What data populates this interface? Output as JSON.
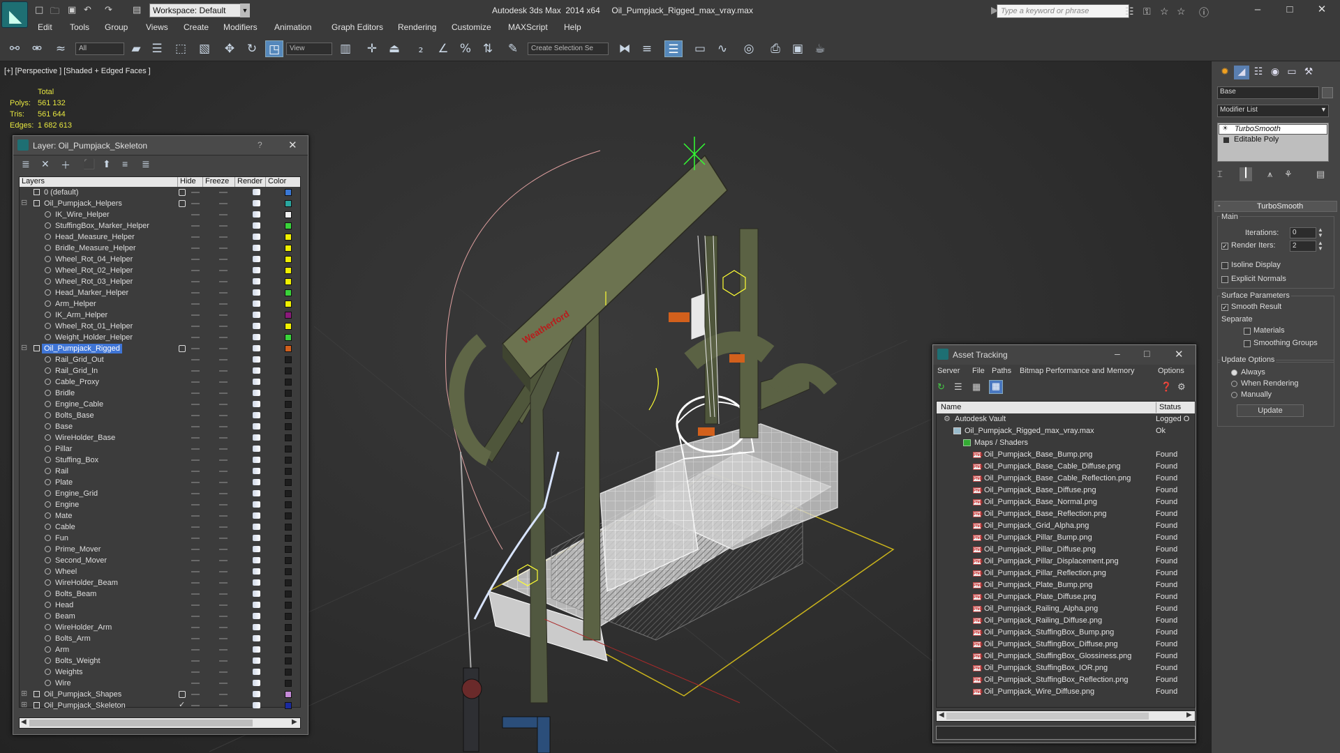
{
  "app": {
    "title": "Autodesk 3ds Max  2014 x64     Oil_Pumpjack_Rigged_max_vray.max",
    "workspace": "Workspace: Default",
    "search_placeholder": "Type a keyword or phrase"
  },
  "menu": [
    "Edit",
    "Tools",
    "Group",
    "Views",
    "Create",
    "Modifiers",
    "Animation",
    "Graph Editors",
    "Rendering",
    "Customize",
    "MAXScript",
    "Help"
  ],
  "toolbar": {
    "selection_filter": "All",
    "reference_coord": "View",
    "selection_set": "Create Selection Se"
  },
  "viewport": {
    "label": "[+] [Perspective ] [Shaded + Edged Faces ]",
    "stats_header": "Total",
    "stats": [
      {
        "k": "Polys:",
        "v": "561 132"
      },
      {
        "k": "Tris:",
        "v": "561 644"
      },
      {
        "k": "Edges:",
        "v": "1 682 613"
      }
    ],
    "decal_text": "Weatherford"
  },
  "layer_dialog": {
    "title": "Layer: Oil_Pumpjack_Skeleton",
    "help": "?",
    "columns": [
      "Layers",
      "Hide",
      "Freeze",
      "Render",
      "Color"
    ],
    "rows": [
      {
        "name": "0 (default)",
        "level": 0,
        "kind": "layer",
        "color": "#3a78d6",
        "cb": true
      },
      {
        "name": "Oil_Pumpjack_Helpers",
        "level": 0,
        "kind": "layer",
        "color": "#2aa7a0",
        "cb": true,
        "expand": "-"
      },
      {
        "name": "IK_Wire_Helper",
        "level": 1,
        "kind": "obj",
        "color": "#f2f2f2"
      },
      {
        "name": "StuffingBox_Marker_Helper",
        "level": 1,
        "kind": "obj",
        "color": "#3ad33a"
      },
      {
        "name": "Head_Measure_Helper",
        "level": 1,
        "kind": "obj",
        "color": "#f0f000"
      },
      {
        "name": "Bridle_Measure_Helper",
        "level": 1,
        "kind": "obj",
        "color": "#f0f000"
      },
      {
        "name": "Wheel_Rot_04_Helper",
        "level": 1,
        "kind": "obj",
        "color": "#f0f000"
      },
      {
        "name": "Wheel_Rot_02_Helper",
        "level": 1,
        "kind": "obj",
        "color": "#f0f000"
      },
      {
        "name": "Wheel_Rot_03_Helper",
        "level": 1,
        "kind": "obj",
        "color": "#f0f000"
      },
      {
        "name": "Head_Marker_Helper",
        "level": 1,
        "kind": "obj",
        "color": "#3ad33a"
      },
      {
        "name": "Arm_Helper",
        "level": 1,
        "kind": "obj",
        "color": "#f0f000"
      },
      {
        "name": "IK_Arm_Helper",
        "level": 1,
        "kind": "obj",
        "color": "#8a1a7a"
      },
      {
        "name": "Wheel_Rot_01_Helper",
        "level": 1,
        "kind": "obj",
        "color": "#f0f000"
      },
      {
        "name": "Weight_Holder_Helper",
        "level": 1,
        "kind": "obj",
        "color": "#3ad33a"
      },
      {
        "name": "Oil_Pumpjack_Rigged",
        "level": 0,
        "kind": "layer",
        "color": "#d2601c",
        "cb": true,
        "expand": "-",
        "selected": true
      },
      {
        "name": "Rail_Grid_Out",
        "level": 1,
        "kind": "obj",
        "color": "#1e1e1e"
      },
      {
        "name": "Rail_Grid_In",
        "level": 1,
        "kind": "obj",
        "color": "#1e1e1e"
      },
      {
        "name": "Cable_Proxy",
        "level": 1,
        "kind": "obj",
        "color": "#1e1e1e"
      },
      {
        "name": "Bridle",
        "level": 1,
        "kind": "obj",
        "color": "#1e1e1e"
      },
      {
        "name": "Engine_Cable",
        "level": 1,
        "kind": "obj",
        "color": "#1e1e1e"
      },
      {
        "name": "Bolts_Base",
        "level": 1,
        "kind": "obj",
        "color": "#1e1e1e"
      },
      {
        "name": "Base",
        "level": 1,
        "kind": "obj",
        "color": "#1e1e1e"
      },
      {
        "name": "WireHolder_Base",
        "level": 1,
        "kind": "obj",
        "color": "#1e1e1e"
      },
      {
        "name": "Pillar",
        "level": 1,
        "kind": "obj",
        "color": "#1e1e1e"
      },
      {
        "name": "Stuffing_Box",
        "level": 1,
        "kind": "obj",
        "color": "#1e1e1e"
      },
      {
        "name": "Rail",
        "level": 1,
        "kind": "obj",
        "color": "#1e1e1e"
      },
      {
        "name": "Plate",
        "level": 1,
        "kind": "obj",
        "color": "#1e1e1e"
      },
      {
        "name": "Engine_Grid",
        "level": 1,
        "kind": "obj",
        "color": "#1e1e1e"
      },
      {
        "name": "Engine",
        "level": 1,
        "kind": "obj",
        "color": "#1e1e1e"
      },
      {
        "name": "Mate",
        "level": 1,
        "kind": "obj",
        "color": "#1e1e1e"
      },
      {
        "name": "Cable",
        "level": 1,
        "kind": "obj",
        "color": "#1e1e1e"
      },
      {
        "name": "Fun",
        "level": 1,
        "kind": "obj",
        "color": "#1e1e1e"
      },
      {
        "name": "Prime_Mover",
        "level": 1,
        "kind": "obj",
        "color": "#1e1e1e"
      },
      {
        "name": "Second_Mover",
        "level": 1,
        "kind": "obj",
        "color": "#1e1e1e"
      },
      {
        "name": "Wheel",
        "level": 1,
        "kind": "obj",
        "color": "#1e1e1e"
      },
      {
        "name": "WireHolder_Beam",
        "level": 1,
        "kind": "obj",
        "color": "#1e1e1e"
      },
      {
        "name": "Bolts_Beam",
        "level": 1,
        "kind": "obj",
        "color": "#1e1e1e"
      },
      {
        "name": "Head",
        "level": 1,
        "kind": "obj",
        "color": "#1e1e1e"
      },
      {
        "name": "Beam",
        "level": 1,
        "kind": "obj",
        "color": "#1e1e1e"
      },
      {
        "name": "WireHolder_Arm",
        "level": 1,
        "kind": "obj",
        "color": "#1e1e1e"
      },
      {
        "name": "Bolts_Arm",
        "level": 1,
        "kind": "obj",
        "color": "#1e1e1e"
      },
      {
        "name": "Arm",
        "level": 1,
        "kind": "obj",
        "color": "#1e1e1e"
      },
      {
        "name": "Bolts_Weight",
        "level": 1,
        "kind": "obj",
        "color": "#1e1e1e"
      },
      {
        "name": "Weights",
        "level": 1,
        "kind": "obj",
        "color": "#1e1e1e"
      },
      {
        "name": "Wire",
        "level": 1,
        "kind": "obj",
        "color": "#1e1e1e"
      },
      {
        "name": "Oil_Pumpjack_Shapes",
        "level": 0,
        "kind": "layer",
        "color": "#c58ad8",
        "cb": true,
        "expand": "+"
      },
      {
        "name": "Oil_Pumpjack_Skeleton",
        "level": 0,
        "kind": "layer",
        "color": "#1a2aa0",
        "check": true,
        "expand": "+"
      }
    ]
  },
  "asset_dialog": {
    "title": "Asset Tracking",
    "menu": [
      "Server",
      "File",
      "Paths",
      "Bitmap Performance and Memory",
      "Options"
    ],
    "columns": [
      "Name",
      "Status"
    ],
    "rows": [
      {
        "name": "Autodesk Vault",
        "status": "Logged O",
        "indent": 0,
        "icon": "vault"
      },
      {
        "name": "Oil_Pumpjack_Rigged_max_vray.max",
        "status": "Ok",
        "indent": 1,
        "icon": "max"
      },
      {
        "name": "Maps / Shaders",
        "status": "",
        "indent": 2,
        "icon": "maps"
      },
      {
        "name": "Oil_Pumpjack_Base_Bump.png",
        "status": "Found",
        "indent": 3,
        "icon": "png"
      },
      {
        "name": "Oil_Pumpjack_Base_Cable_Diffuse.png",
        "status": "Found",
        "indent": 3,
        "icon": "png"
      },
      {
        "name": "Oil_Pumpjack_Base_Cable_Reflection.png",
        "status": "Found",
        "indent": 3,
        "icon": "png"
      },
      {
        "name": "Oil_Pumpjack_Base_Diffuse.png",
        "status": "Found",
        "indent": 3,
        "icon": "png"
      },
      {
        "name": "Oil_Pumpjack_Base_Normal.png",
        "status": "Found",
        "indent": 3,
        "icon": "png"
      },
      {
        "name": "Oil_Pumpjack_Base_Reflection.png",
        "status": "Found",
        "indent": 3,
        "icon": "png"
      },
      {
        "name": "Oil_Pumpjack_Grid_Alpha.png",
        "status": "Found",
        "indent": 3,
        "icon": "png"
      },
      {
        "name": "Oil_Pumpjack_Pillar_Bump.png",
        "status": "Found",
        "indent": 3,
        "icon": "png"
      },
      {
        "name": "Oil_Pumpjack_Pillar_Diffuse.png",
        "status": "Found",
        "indent": 3,
        "icon": "png"
      },
      {
        "name": "Oil_Pumpjack_Pillar_Displacement.png",
        "status": "Found",
        "indent": 3,
        "icon": "png"
      },
      {
        "name": "Oil_Pumpjack_Pillar_Reflection.png",
        "status": "Found",
        "indent": 3,
        "icon": "png"
      },
      {
        "name": "Oil_Pumpjack_Plate_Bump.png",
        "status": "Found",
        "indent": 3,
        "icon": "png"
      },
      {
        "name": "Oil_Pumpjack_Plate_Diffuse.png",
        "status": "Found",
        "indent": 3,
        "icon": "png"
      },
      {
        "name": "Oil_Pumpjack_Railing_Alpha.png",
        "status": "Found",
        "indent": 3,
        "icon": "png"
      },
      {
        "name": "Oil_Pumpjack_Railing_Diffuse.png",
        "status": "Found",
        "indent": 3,
        "icon": "png"
      },
      {
        "name": "Oil_Pumpjack_StuffingBox_Bump.png",
        "status": "Found",
        "indent": 3,
        "icon": "png"
      },
      {
        "name": "Oil_Pumpjack_StuffingBox_Diffuse.png",
        "status": "Found",
        "indent": 3,
        "icon": "png"
      },
      {
        "name": "Oil_Pumpjack_StuffingBox_Glossiness.png",
        "status": "Found",
        "indent": 3,
        "icon": "png"
      },
      {
        "name": "Oil_Pumpjack_StuffingBox_IOR.png",
        "status": "Found",
        "indent": 3,
        "icon": "png"
      },
      {
        "name": "Oil_Pumpjack_StuffingBox_Reflection.png",
        "status": "Found",
        "indent": 3,
        "icon": "png"
      },
      {
        "name": "Oil_Pumpjack_Wire_Diffuse.png",
        "status": "Found",
        "indent": 3,
        "icon": "png"
      }
    ]
  },
  "command_panel": {
    "object_name": "Base",
    "modifier_list": "Modifier List",
    "stack": [
      "TurboSmooth",
      "Editable Poly"
    ],
    "rollout_title": "TurboSmooth",
    "main_label": "Main",
    "iterations_label": "Iterations:",
    "iterations_value": "0",
    "render_iters_label": "Render Iters:",
    "render_iters_value": "2",
    "isoline": "Isoline Display",
    "explicit_normals": "Explicit Normals",
    "surface_params": "Surface Parameters",
    "smooth_result": "Smooth Result",
    "separate": "Separate",
    "materials": "Materials",
    "smoothing_groups": "Smoothing Groups",
    "update_options": "Update Options",
    "always": "Always",
    "when_rendering": "When Rendering",
    "manually": "Manually",
    "update_button": "Update"
  },
  "colors": {
    "selection": "#3f75d6",
    "accent": "#1e6f73",
    "stats": "#e6e640"
  }
}
